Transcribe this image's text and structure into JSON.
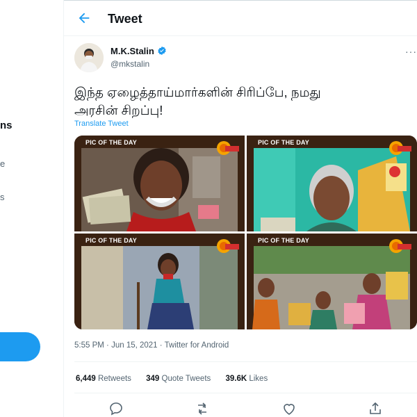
{
  "sidebar": {
    "fragment_ns": "ns",
    "fragment_e": "e",
    "fragment_s": "s",
    "tweet_button_color": "#1d9bf0"
  },
  "header": {
    "back_icon": "arrow-left-icon",
    "title": "Tweet"
  },
  "tweet": {
    "author": {
      "name": "M.K.Stalin",
      "handle": "@mkstalin",
      "verified": true
    },
    "more_icon": "more-horizontal-icon",
    "more_label": "···",
    "text_line1": "இந்த ஏழைத்தாய்மார்களின் சிரிப்பே, நமது",
    "text_line2": "அரசின் சிறப்பு!",
    "translate_label": "Translate Tweet",
    "media": [
      {
        "label": "PIC OF THE DAY",
        "badge": "SUN NEWS"
      },
      {
        "label": "PIC OF THE DAY",
        "badge": "SUN NEWS"
      },
      {
        "label": "PIC OF THE DAY",
        "badge": "SUN NEWS"
      },
      {
        "label": "PIC OF THE DAY",
        "badge": "SUN NEWS"
      }
    ],
    "time": "5:55 PM",
    "date": "Jun 15, 2021",
    "source": "Twitter for Android",
    "separator": "·",
    "stats": {
      "retweets_count": "6,449",
      "retweets_label": "Retweets",
      "quotes_count": "349",
      "quotes_label": "Quote Tweets",
      "likes_count": "39.6K",
      "likes_label": "Likes"
    },
    "actions": [
      "reply-icon",
      "retweet-icon",
      "like-icon",
      "share-icon"
    ]
  },
  "colors": {
    "accent": "#1d9bf0",
    "text_secondary": "#536471",
    "border": "#eff3f4"
  }
}
